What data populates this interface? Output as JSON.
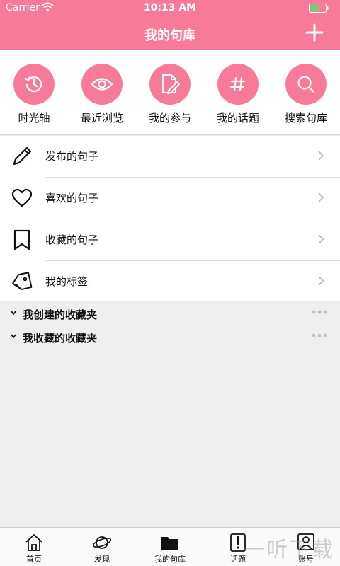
{
  "status": {
    "carrier": "Carrier",
    "time": "10:13 AM"
  },
  "header": {
    "title": "我的句库"
  },
  "colors": {
    "accent": "#f77a98"
  },
  "quick_actions": [
    {
      "label": "时光轴",
      "icon": "history-icon"
    },
    {
      "label": "最近浏览",
      "icon": "eye-icon"
    },
    {
      "label": "我的参与",
      "icon": "edit-document-icon"
    },
    {
      "label": "我的话题",
      "icon": "hashtag-icon"
    },
    {
      "label": "搜索句库",
      "icon": "search-icon"
    }
  ],
  "menu": [
    {
      "label": "发布的句子",
      "icon": "pencil-icon"
    },
    {
      "label": "喜欢的句子",
      "icon": "heart-icon"
    },
    {
      "label": "收藏的句子",
      "icon": "bookmark-icon"
    },
    {
      "label": "我的标签",
      "icon": "tag-icon"
    }
  ],
  "folders": [
    {
      "label": "我创建的收藏夹"
    },
    {
      "label": "我收藏的收藏夹"
    }
  ],
  "tabs": [
    {
      "label": "首页",
      "icon": "home-icon"
    },
    {
      "label": "发现",
      "icon": "planet-icon"
    },
    {
      "label": "我的句库",
      "icon": "folder-icon"
    },
    {
      "label": "话题",
      "icon": "topic-icon"
    },
    {
      "label": "账号",
      "icon": "account-icon"
    }
  ],
  "watermark": "一听下载"
}
